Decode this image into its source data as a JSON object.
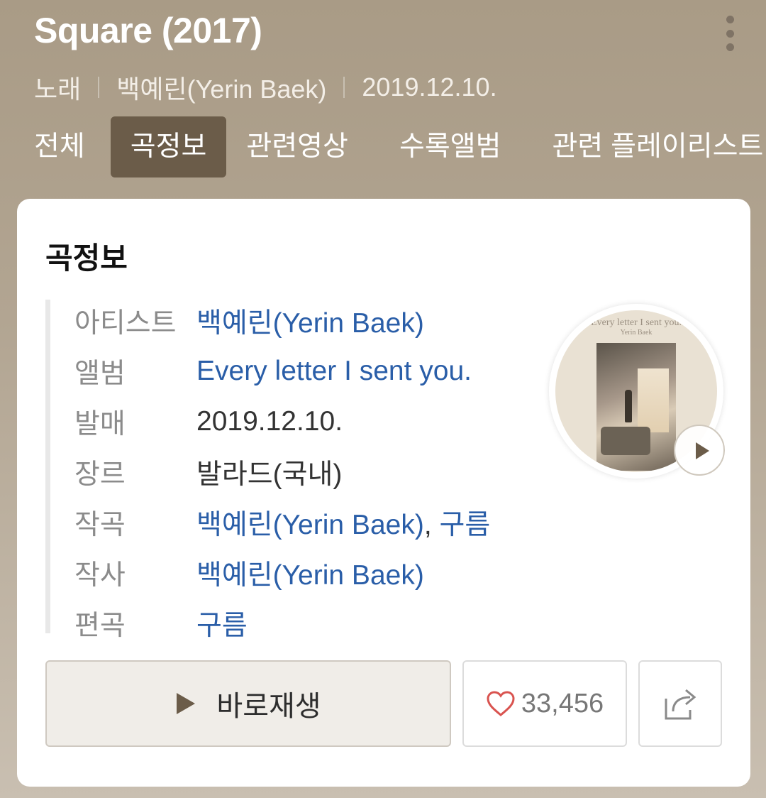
{
  "header": {
    "title": "Square (2017)",
    "meta": {
      "type": "노래",
      "artist": "백예린(Yerin Baek)",
      "date": "2019.12.10."
    },
    "tabs": [
      {
        "label": "전체",
        "active": false
      },
      {
        "label": "곡정보",
        "active": true
      },
      {
        "label": "관련영상",
        "active": false
      },
      {
        "label": "수록앨범",
        "active": false
      },
      {
        "label": "관련 플레이리스트",
        "active": false
      }
    ]
  },
  "card": {
    "title": "곡정보",
    "rows": [
      {
        "label": "아티스트",
        "value": "백예린(Yerin Baek)"
      },
      {
        "label": "앨범",
        "value": "Every letter I sent you."
      },
      {
        "label": "발매",
        "value": "2019.12.10."
      },
      {
        "label": "장르",
        "value": "발라드(국내)"
      },
      {
        "label": "작곡",
        "value": "백예린(Yerin Baek)",
        "separator": ", ",
        "value2": "구름"
      },
      {
        "label": "작사",
        "value": "백예린(Yerin Baek)"
      },
      {
        "label": "편곡",
        "value": "구름"
      }
    ],
    "album_cover": {
      "title_text": "Every letter I sent you.",
      "sub_text": "Yerin Baek"
    },
    "buttons": {
      "play_label": "바로재생",
      "like_count": "33,456"
    }
  },
  "colors": {
    "link": "#2a5ea8",
    "active_tab_bg": "#6b5c49",
    "heart": "#d9534f"
  },
  "icons": {
    "more": "more-vertical-icon",
    "play": "play-icon",
    "heart": "heart-outline-icon",
    "share": "share-icon"
  }
}
